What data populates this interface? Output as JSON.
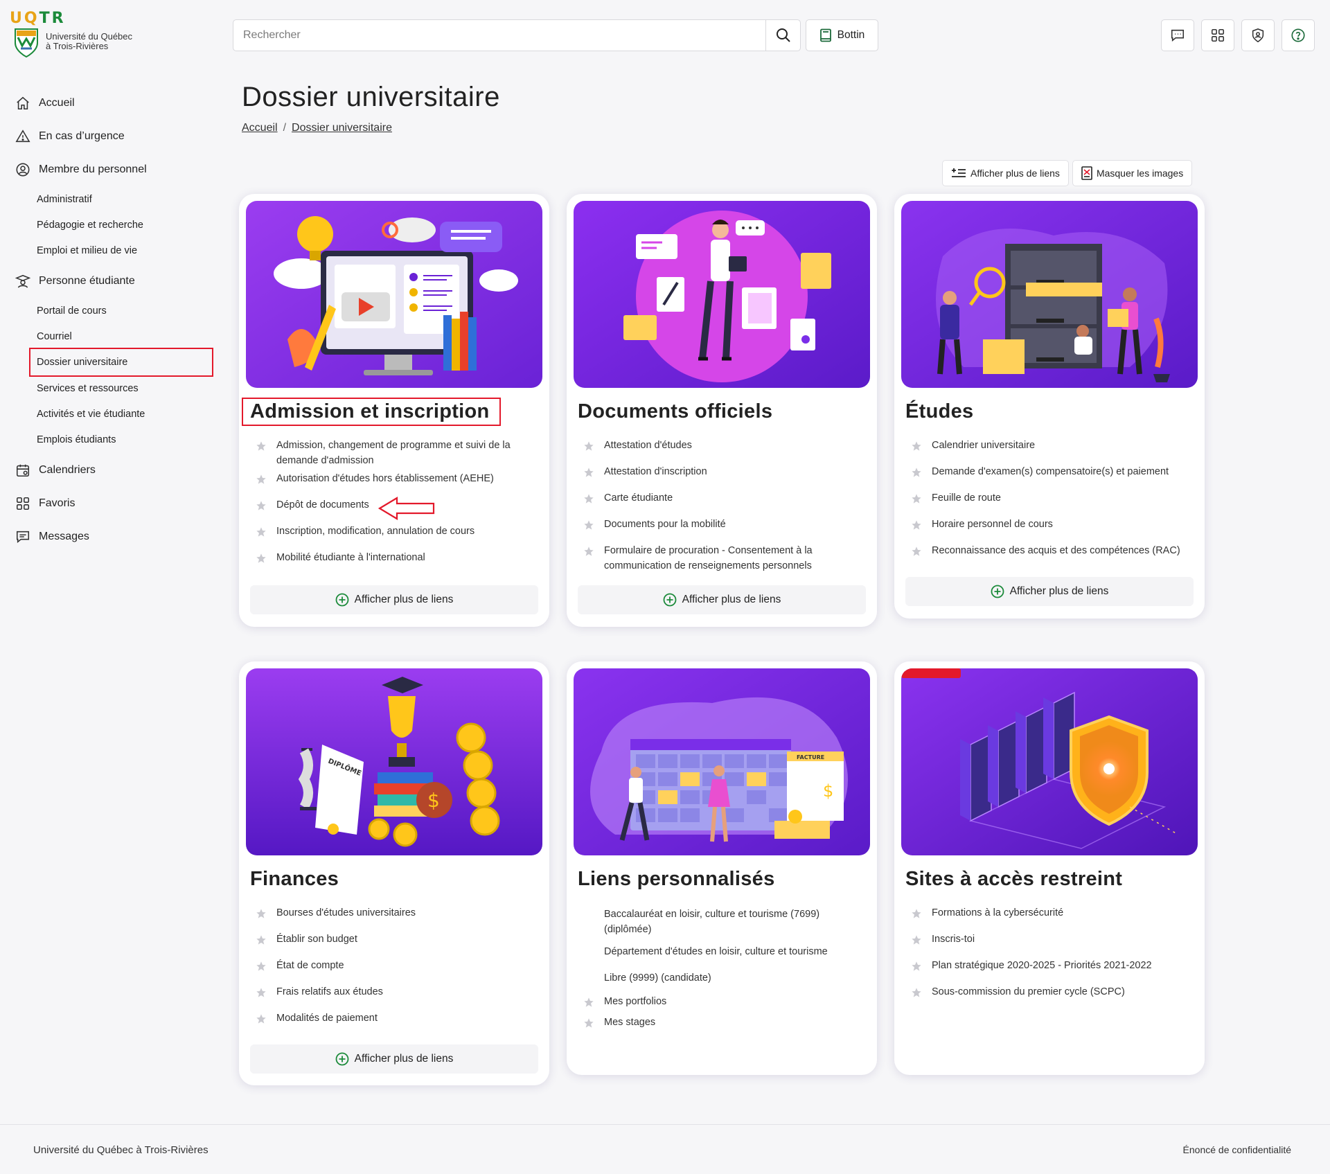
{
  "logo": {
    "word_a": "UQ",
    "word_b": "TR",
    "name_line1": "Université du Québec",
    "name_line2": "à Trois-Rivières"
  },
  "search": {
    "placeholder": "Rechercher"
  },
  "header": {
    "bottin_label": "Bottin"
  },
  "sidebar": {
    "items": [
      {
        "label": "Accueil",
        "icon": "home-icon"
      },
      {
        "label": "En cas d’urgence",
        "icon": "warning-icon"
      },
      {
        "label": "Membre du personnel",
        "icon": "user-circle-icon",
        "children": [
          "Administratif",
          "Pédagogie et recherche",
          "Emploi et milieu de vie"
        ]
      },
      {
        "label": "Personne étudiante",
        "icon": "student-icon",
        "children": [
          "Portail de cours",
          "Courriel",
          "Dossier universitaire",
          "Services et ressources",
          "Activités et vie étudiante",
          "Emplois étudiants"
        ]
      },
      {
        "label": "Calendriers",
        "icon": "calendar-icon"
      },
      {
        "label": "Favoris",
        "icon": "grid-icon"
      },
      {
        "label": "Messages",
        "icon": "chat-icon"
      }
    ],
    "active_child": "Dossier universitaire"
  },
  "page": {
    "title": "Dossier universitaire",
    "breadcrumb": [
      "Accueil",
      "Dossier universitaire"
    ]
  },
  "actions": {
    "show_more_links": "Afficher plus de liens",
    "hide_images": "Masquer les images"
  },
  "more_label": "Afficher plus de liens",
  "cards": [
    {
      "title": "Admission et inscription",
      "links": [
        "Admission, changement de programme et suivi de la demande d'admission",
        "Autorisation d'études hors établissement (AEHE)",
        "Dépôt de documents",
        "Inscription, modification, annulation de cours",
        "Mobilité étudiante à l'international"
      ]
    },
    {
      "title": "Documents officiels",
      "links": [
        "Attestation d'études",
        "Attestation d'inscription",
        "Carte étudiante",
        "Documents pour la mobilité",
        "Formulaire de procuration - Consentement à la communication de renseignements personnels"
      ]
    },
    {
      "title": "Études",
      "links": [
        "Calendrier universitaire",
        "Demande d'examen(s) compensatoire(s) et paiement",
        "Feuille de route",
        "Horaire personnel de cours",
        "Reconnaissance des acquis et des compétences (RAC)"
      ]
    },
    {
      "title": "Finances",
      "links": [
        "Bourses d'études universitaires",
        "Établir son budget",
        "État de compte",
        "Frais relatifs aux études",
        "Modalités de paiement"
      ]
    },
    {
      "title": "Liens personnalisés",
      "links": [
        "Baccalauréat en loisir, culture et tourisme (7699) (diplômée)",
        "Département d'études en loisir, culture et tourisme",
        "Libre (9999) (candidate)",
        "Mes portfolios",
        "Mes stages"
      ]
    },
    {
      "title": "Sites à accès restreint",
      "links": [
        "Formations à la cybersécurité",
        "Inscris-toi",
        "Plan stratégique 2020-2025 - Priorités 2021-2022",
        "Sous-commission du premier cycle (SCPC)"
      ]
    }
  ],
  "illustration": {
    "diploma_text": "DIPLÔME",
    "invoice_text": "FACTURE"
  },
  "footer": {
    "left": "Université du Québec à Trois-Rivières",
    "right": "Énoncé de confidentialité"
  },
  "colors": {
    "accent_red": "#e3192b",
    "purple": "#7a2ee8",
    "green": "#1b8a3a"
  }
}
